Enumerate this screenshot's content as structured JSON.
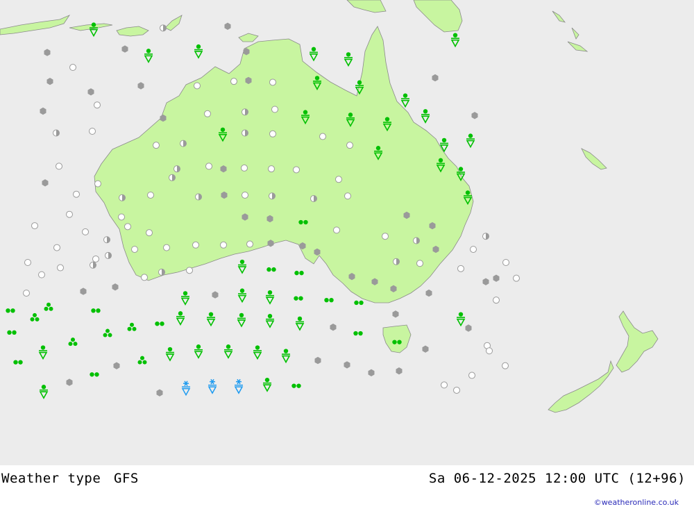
{
  "footer": {
    "title": "Weather type",
    "model": "GFS",
    "valid_time": "Sa 06-12-2025 12:00 UTC (12+96)",
    "credit": "©weatheronline.co.uk"
  },
  "colors": {
    "ocean": "#ececec",
    "land": "#c8f5a0",
    "coast": "#8a8a8a",
    "rain": "#00c000",
    "snow": "#1e9bf0",
    "cloud": "#9a9a9a",
    "clear_outline": "#9a9a9a"
  },
  "symbol_legend": {
    "clear": "open-circle",
    "partly-cloudy": "half-filled-circle",
    "overcast": "filled-grey-hexagon",
    "drizzle": "two-green-dots",
    "rain": "three-green-dots",
    "rain-shower": "green-dot-over-triangle",
    "snow-shower": "blue-star-over-triangle"
  },
  "weather_symbols": [
    {
      "t": "rain-shower",
      "lon": 113.5,
      "lat": -8.3
    },
    {
      "t": "partly-cloudy",
      "lon": 123.5,
      "lat": -8.2
    },
    {
      "t": "cloudy",
      "lon": 132.8,
      "lat": -8.0
    },
    {
      "t": "cloudy",
      "lon": 106.8,
      "lat": -11.0
    },
    {
      "t": "cloudy",
      "lon": 118.0,
      "lat": -10.6
    },
    {
      "t": "rain-shower",
      "lon": 121.4,
      "lat": -11.3
    },
    {
      "t": "rain-shower",
      "lon": 128.6,
      "lat": -10.8
    },
    {
      "t": "cloudy",
      "lon": 135.5,
      "lat": -10.9
    },
    {
      "t": "rain-shower",
      "lon": 145.2,
      "lat": -11.1
    },
    {
      "t": "rain-shower",
      "lon": 150.2,
      "lat": -11.7
    },
    {
      "t": "rain-shower",
      "lon": 165.6,
      "lat": -9.5
    },
    {
      "t": "clear",
      "lon": 110.5,
      "lat": -12.7
    },
    {
      "t": "cloudy",
      "lon": 107.2,
      "lat": -14.3
    },
    {
      "t": "cloudy",
      "lon": 113.1,
      "lat": -15.5
    },
    {
      "t": "cloudy",
      "lon": 120.3,
      "lat": -14.8
    },
    {
      "t": "clear",
      "lon": 128.4,
      "lat": -14.8
    },
    {
      "t": "clear",
      "lon": 133.7,
      "lat": -14.3
    },
    {
      "t": "cloudy",
      "lon": 135.8,
      "lat": -14.2
    },
    {
      "t": "clear",
      "lon": 139.3,
      "lat": -14.4
    },
    {
      "t": "rain-shower",
      "lon": 145.7,
      "lat": -14.4
    },
    {
      "t": "rain-shower",
      "lon": 151.8,
      "lat": -14.9
    },
    {
      "t": "cloudy",
      "lon": 162.7,
      "lat": -13.9
    },
    {
      "t": "clear",
      "lon": 114.0,
      "lat": -17.0
    },
    {
      "t": "cloudy",
      "lon": 106.2,
      "lat": -17.7
    },
    {
      "t": "rain-shower",
      "lon": 158.4,
      "lat": -16.4
    },
    {
      "t": "cloudy",
      "lon": 123.5,
      "lat": -18.5
    },
    {
      "t": "clear",
      "lon": 129.9,
      "lat": -18.0
    },
    {
      "t": "partly-cloudy",
      "lon": 135.3,
      "lat": -17.8
    },
    {
      "t": "clear",
      "lon": 139.6,
      "lat": -17.5
    },
    {
      "t": "rain-shower",
      "lon": 144.0,
      "lat": -18.3
    },
    {
      "t": "rain-shower",
      "lon": 150.5,
      "lat": -18.6
    },
    {
      "t": "rain-shower",
      "lon": 155.8,
      "lat": -19.1
    },
    {
      "t": "rain-shower",
      "lon": 161.3,
      "lat": -18.2
    },
    {
      "t": "cloudy",
      "lon": 168.4,
      "lat": -18.2
    },
    {
      "t": "partly-cloudy",
      "lon": 108.1,
      "lat": -20.2
    },
    {
      "t": "clear",
      "lon": 113.3,
      "lat": -20.0
    },
    {
      "t": "rain-shower",
      "lon": 132.1,
      "lat": -20.3
    },
    {
      "t": "partly-cloudy",
      "lon": 135.3,
      "lat": -20.2
    },
    {
      "t": "clear",
      "lon": 139.3,
      "lat": -20.3
    },
    {
      "t": "clear",
      "lon": 146.5,
      "lat": -20.6
    },
    {
      "t": "clear",
      "lon": 122.5,
      "lat": -21.6
    },
    {
      "t": "partly-cloudy",
      "lon": 126.4,
      "lat": -21.4
    },
    {
      "t": "clear",
      "lon": 150.4,
      "lat": -21.6
    },
    {
      "t": "rain-shower",
      "lon": 154.5,
      "lat": -22.4
    },
    {
      "t": "rain-shower",
      "lon": 164.0,
      "lat": -21.5
    },
    {
      "t": "rain-shower",
      "lon": 167.8,
      "lat": -21.0
    },
    {
      "t": "clear",
      "lon": 108.5,
      "lat": -24.0
    },
    {
      "t": "partly-cloudy",
      "lon": 125.5,
      "lat": -24.3
    },
    {
      "t": "clear",
      "lon": 130.1,
      "lat": -24.0
    },
    {
      "t": "cloudy",
      "lon": 132.2,
      "lat": -24.3
    },
    {
      "t": "clear",
      "lon": 135.2,
      "lat": -24.2
    },
    {
      "t": "clear",
      "lon": 139.1,
      "lat": -24.3
    },
    {
      "t": "clear",
      "lon": 142.7,
      "lat": -24.4
    },
    {
      "t": "rain-shower",
      "lon": 163.5,
      "lat": -23.8
    },
    {
      "t": "cloudy",
      "lon": 106.5,
      "lat": -25.9
    },
    {
      "t": "clear",
      "lon": 114.1,
      "lat": -26.0
    },
    {
      "t": "partly-cloudy",
      "lon": 124.8,
      "lat": -25.3
    },
    {
      "t": "clear",
      "lon": 148.8,
      "lat": -25.5
    },
    {
      "t": "rain-shower",
      "lon": 166.4,
      "lat": -24.8
    },
    {
      "t": "clear",
      "lon": 111.0,
      "lat": -27.2
    },
    {
      "t": "partly-cloudy",
      "lon": 117.6,
      "lat": -27.6
    },
    {
      "t": "clear",
      "lon": 121.7,
      "lat": -27.3
    },
    {
      "t": "partly-cloudy",
      "lon": 128.6,
      "lat": -27.5
    },
    {
      "t": "cloudy",
      "lon": 132.3,
      "lat": -27.3
    },
    {
      "t": "clear",
      "lon": 135.3,
      "lat": -27.3
    },
    {
      "t": "partly-cloudy",
      "lon": 139.2,
      "lat": -27.4
    },
    {
      "t": "partly-cloudy",
      "lon": 145.2,
      "lat": -27.7
    },
    {
      "t": "clear",
      "lon": 150.1,
      "lat": -27.4
    },
    {
      "t": "rain-shower",
      "lon": 167.4,
      "lat": -27.5
    },
    {
      "t": "clear",
      "lon": 110.0,
      "lat": -29.5
    },
    {
      "t": "clear",
      "lon": 117.5,
      "lat": -29.8
    },
    {
      "t": "cloudy",
      "lon": 135.3,
      "lat": -29.8
    },
    {
      "t": "cloudy",
      "lon": 138.9,
      "lat": -30.0
    },
    {
      "t": "drizzle",
      "lon": 143.7,
      "lat": -30.4
    },
    {
      "t": "cloudy",
      "lon": 158.6,
      "lat": -29.6
    },
    {
      "t": "clear",
      "lon": 105.0,
      "lat": -30.8
    },
    {
      "t": "clear",
      "lon": 112.3,
      "lat": -31.5
    },
    {
      "t": "partly-cloudy",
      "lon": 115.4,
      "lat": -32.4
    },
    {
      "t": "clear",
      "lon": 118.4,
      "lat": -30.9
    },
    {
      "t": "clear",
      "lon": 121.5,
      "lat": -31.6
    },
    {
      "t": "cloudy",
      "lon": 139.0,
      "lat": -32.8
    },
    {
      "t": "cloudy",
      "lon": 143.6,
      "lat": -33.1
    },
    {
      "t": "clear",
      "lon": 148.5,
      "lat": -31.3
    },
    {
      "t": "clear",
      "lon": 155.5,
      "lat": -32.0
    },
    {
      "t": "partly-cloudy",
      "lon": 160.0,
      "lat": -32.5
    },
    {
      "t": "cloudy",
      "lon": 162.3,
      "lat": -30.8
    },
    {
      "t": "partly-cloudy",
      "lon": 170.0,
      "lat": -32.0
    },
    {
      "t": "clear",
      "lon": 108.2,
      "lat": -33.3
    },
    {
      "t": "partly-cloudy",
      "lon": 115.6,
      "lat": -34.2
    },
    {
      "t": "clear",
      "lon": 119.4,
      "lat": -33.5
    },
    {
      "t": "clear",
      "lon": 124.0,
      "lat": -33.3
    },
    {
      "t": "clear",
      "lon": 128.2,
      "lat": -33.0
    },
    {
      "t": "clear",
      "lon": 132.2,
      "lat": -33.0
    },
    {
      "t": "clear",
      "lon": 136.0,
      "lat": -32.9
    },
    {
      "t": "cloudy",
      "lon": 145.7,
      "lat": -33.8
    },
    {
      "t": "cloudy",
      "lon": 162.8,
      "lat": -33.5
    },
    {
      "t": "clear",
      "lon": 168.2,
      "lat": -33.5
    },
    {
      "t": "clear",
      "lon": 104.0,
      "lat": -35.0
    },
    {
      "t": "partly-cloudy",
      "lon": 113.4,
      "lat": -35.3
    },
    {
      "t": "clear",
      "lon": 113.8,
      "lat": -34.6
    },
    {
      "t": "clear",
      "lon": 108.7,
      "lat": -35.6
    },
    {
      "t": "partly-cloudy",
      "lon": 123.3,
      "lat": -36.1
    },
    {
      "t": "clear",
      "lon": 127.3,
      "lat": -35.9
    },
    {
      "t": "rain-shower",
      "lon": 134.9,
      "lat": -35.4
    },
    {
      "t": "drizzle",
      "lon": 139.1,
      "lat": -35.8
    },
    {
      "t": "drizzle",
      "lon": 143.1,
      "lat": -36.2
    },
    {
      "t": "cloudy",
      "lon": 150.7,
      "lat": -36.6
    },
    {
      "t": "partly-cloudy",
      "lon": 157.1,
      "lat": -34.9
    },
    {
      "t": "clear",
      "lon": 160.5,
      "lat": -35.1
    },
    {
      "t": "clear",
      "lon": 166.4,
      "lat": -35.7
    },
    {
      "t": "cloudy",
      "lon": 171.5,
      "lat": -36.8
    },
    {
      "t": "clear",
      "lon": 172.9,
      "lat": -35.0
    },
    {
      "t": "clear",
      "lon": 106.0,
      "lat": -36.4
    },
    {
      "t": "cloudy",
      "lon": 116.6,
      "lat": -37.8
    },
    {
      "t": "clear",
      "lon": 120.8,
      "lat": -36.7
    },
    {
      "t": "cloudy",
      "lon": 154.0,
      "lat": -37.2
    },
    {
      "t": "clear",
      "lon": 174.4,
      "lat": -36.8
    },
    {
      "t": "cloudy",
      "lon": 112.0,
      "lat": -38.3
    },
    {
      "t": "clear",
      "lon": 103.8,
      "lat": -38.5
    },
    {
      "t": "rain-shower",
      "lon": 126.7,
      "lat": -39.0
    },
    {
      "t": "cloudy",
      "lon": 131.0,
      "lat": -38.7
    },
    {
      "t": "rain-shower",
      "lon": 134.9,
      "lat": -38.7
    },
    {
      "t": "rain-shower",
      "lon": 138.9,
      "lat": -38.9
    },
    {
      "t": "drizzle",
      "lon": 143.0,
      "lat": -39.1
    },
    {
      "t": "drizzle",
      "lon": 147.4,
      "lat": -39.3
    },
    {
      "t": "drizzle",
      "lon": 151.7,
      "lat": -39.6
    },
    {
      "t": "cloudy",
      "lon": 161.8,
      "lat": -38.5
    },
    {
      "t": "cloudy",
      "lon": 156.7,
      "lat": -38.0
    },
    {
      "t": "cloudy",
      "lon": 170.0,
      "lat": -37.2
    },
    {
      "t": "clear",
      "lon": 171.5,
      "lat": -39.3
    },
    {
      "t": "drizzle",
      "lon": 101.5,
      "lat": -40.5
    },
    {
      "t": "rain",
      "lon": 107.0,
      "lat": -40.1
    },
    {
      "t": "drizzle",
      "lon": 113.8,
      "lat": -40.5
    },
    {
      "t": "cloudy",
      "lon": 157.0,
      "lat": -40.9
    },
    {
      "t": "rain",
      "lon": 105.0,
      "lat": -41.3
    },
    {
      "t": "rain-shower",
      "lon": 126.0,
      "lat": -41.3
    },
    {
      "t": "rain-shower",
      "lon": 130.4,
      "lat": -41.4
    },
    {
      "t": "rain-shower",
      "lon": 134.8,
      "lat": -41.5
    },
    {
      "t": "rain-shower",
      "lon": 138.9,
      "lat": -41.6
    },
    {
      "t": "rain-shower",
      "lon": 143.2,
      "lat": -41.9
    },
    {
      "t": "drizzle",
      "lon": 123.0,
      "lat": -42.0
    },
    {
      "t": "rain",
      "lon": 119.0,
      "lat": -42.4
    },
    {
      "t": "cloudy",
      "lon": 148.0,
      "lat": -42.4
    },
    {
      "t": "rain-shower",
      "lon": 166.4,
      "lat": -41.4
    },
    {
      "t": "cloudy",
      "lon": 167.5,
      "lat": -42.5
    },
    {
      "t": "drizzle",
      "lon": 101.7,
      "lat": -43.0
    },
    {
      "t": "rain",
      "lon": 115.5,
      "lat": -43.1
    },
    {
      "t": "drizzle",
      "lon": 151.6,
      "lat": -43.1
    },
    {
      "t": "drizzle",
      "lon": 157.2,
      "lat": -44.1
    },
    {
      "t": "rain",
      "lon": 110.5,
      "lat": -44.1
    },
    {
      "t": "clear",
      "lon": 170.2,
      "lat": -44.5
    },
    {
      "t": "rain-shower",
      "lon": 106.2,
      "lat": -45.2
    },
    {
      "t": "rain-shower",
      "lon": 124.5,
      "lat": -45.4
    },
    {
      "t": "rain-shower",
      "lon": 128.6,
      "lat": -45.1
    },
    {
      "t": "rain-shower",
      "lon": 132.9,
      "lat": -45.1
    },
    {
      "t": "rain-shower",
      "lon": 137.1,
      "lat": -45.2
    },
    {
      "t": "rain-shower",
      "lon": 141.2,
      "lat": -45.6
    },
    {
      "t": "cloudy",
      "lon": 161.3,
      "lat": -44.9
    },
    {
      "t": "clear",
      "lon": 170.5,
      "lat": -45.1
    },
    {
      "t": "drizzle",
      "lon": 102.6,
      "lat": -46.4
    },
    {
      "t": "rain",
      "lon": 120.5,
      "lat": -46.2
    },
    {
      "t": "cloudy",
      "lon": 145.8,
      "lat": -46.2
    },
    {
      "t": "cloudy",
      "lon": 150.0,
      "lat": -46.7
    },
    {
      "t": "cloudy",
      "lon": 116.8,
      "lat": -46.8
    },
    {
      "t": "clear",
      "lon": 172.8,
      "lat": -46.8
    },
    {
      "t": "drizzle",
      "lon": 113.6,
      "lat": -47.8
    },
    {
      "t": "cloudy",
      "lon": 153.5,
      "lat": -47.6
    },
    {
      "t": "cloudy",
      "lon": 157.5,
      "lat": -47.4
    },
    {
      "t": "clear",
      "lon": 168.0,
      "lat": -47.9
    },
    {
      "t": "cloudy",
      "lon": 110.0,
      "lat": -48.7
    },
    {
      "t": "clear",
      "lon": 164.0,
      "lat": -49.0
    },
    {
      "t": "rain-shower",
      "lon": 106.3,
      "lat": -49.7
    },
    {
      "t": "cloudy",
      "lon": 123.0,
      "lat": -49.9
    },
    {
      "t": "snow-shower",
      "lon": 126.8,
      "lat": -49.3
    },
    {
      "t": "snow-shower",
      "lon": 130.6,
      "lat": -49.1
    },
    {
      "t": "snow-shower",
      "lon": 134.4,
      "lat": -49.1
    },
    {
      "t": "rain-shower",
      "lon": 138.5,
      "lat": -48.9
    },
    {
      "t": "drizzle",
      "lon": 142.7,
      "lat": -49.1
    },
    {
      "t": "clear",
      "lon": 165.8,
      "lat": -49.6
    }
  ]
}
